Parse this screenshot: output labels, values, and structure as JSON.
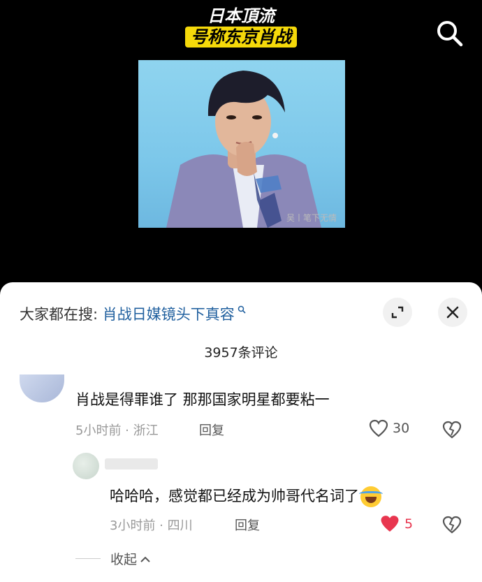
{
  "video": {
    "title_line1": "日本頂流",
    "title_line2": "号称东京肖战",
    "watermark": "吴丨笔下无情",
    "icons": {
      "search": "search-icon"
    }
  },
  "sheet": {
    "search_prefix": "大家都在搜:",
    "search_query": "肖战日媒镜头下真容",
    "comment_count": "3957条评论",
    "icons": {
      "expand": "expand-icon",
      "close": "close-icon"
    }
  },
  "comments": [
    {
      "text": "肖战是得罪谁了 那那国家明星都要粘一",
      "meta": "5小时前 · 浙江",
      "reply_label": "回复",
      "likes": "30",
      "liked": false
    },
    {
      "text": "哈哈哈，感觉都已经成为帅哥代名词了",
      "meta": "3小时前 · 四川",
      "reply_label": "回复",
      "likes": "5",
      "liked": true
    }
  ],
  "collapse_label": "收起",
  "colors": {
    "liked": "#e8364f",
    "link": "#1f5f9e",
    "highlight": "#f5d90a"
  }
}
